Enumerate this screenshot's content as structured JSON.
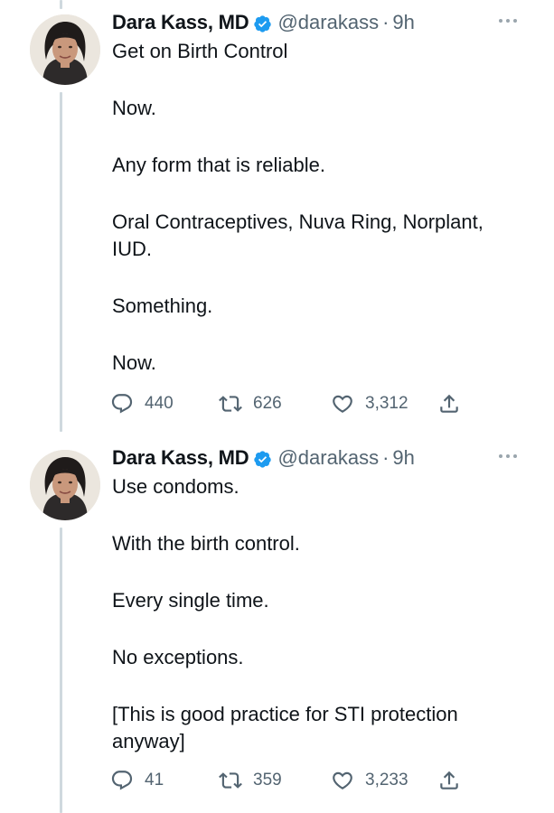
{
  "tweets": [
    {
      "author": {
        "name": "Dara Kass, MD",
        "handle": "@darakass",
        "verified": true
      },
      "time": "9h",
      "separator": "·",
      "paragraphs": [
        "Get on Birth Control",
        "Now.",
        "Any form that is reliable.",
        "Oral Contraceptives, Nuva Ring, Norplant, IUD.",
        "Something.",
        "Now."
      ],
      "stats": {
        "replies": "440",
        "retweets": "626",
        "likes": "3,312"
      }
    },
    {
      "author": {
        "name": "Dara Kass, MD",
        "handle": "@darakass",
        "verified": true
      },
      "time": "9h",
      "separator": "·",
      "paragraphs": [
        "Use condoms.",
        "With the birth control.",
        "Every single time.",
        "No exceptions.",
        "[This is good practice for STI protection anyway]"
      ],
      "stats": {
        "replies": "41",
        "retweets": "359",
        "likes": "3,233"
      }
    }
  ],
  "icons": {
    "reply": "reply-icon",
    "retweet": "retweet-icon",
    "like": "heart-icon",
    "share": "share-icon",
    "more": "more-options-icon",
    "verified": "verified-badge-icon"
  },
  "colors": {
    "text": "#0f1419",
    "secondary": "#536471",
    "verified": "#1d9bf0",
    "thread_line": "#cfd9de"
  }
}
